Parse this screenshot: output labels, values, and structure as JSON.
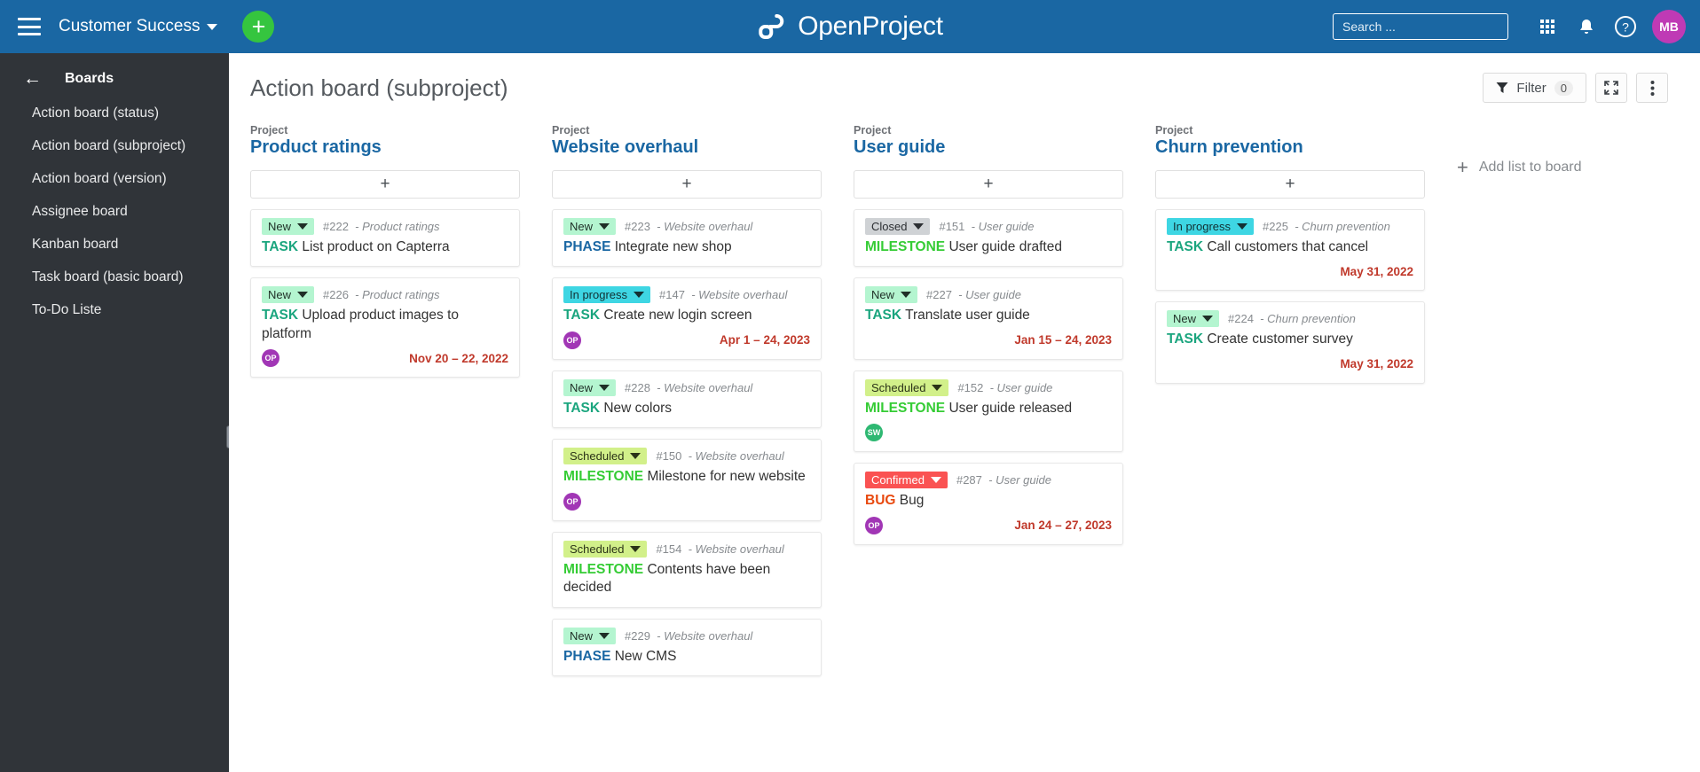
{
  "topbar": {
    "menu_icon": "hamburger-icon",
    "project_name": "Customer Success",
    "add_label": "+",
    "logo_text": "OpenProject",
    "search_placeholder": "Search ...",
    "search_value": "",
    "user_initials": "MB",
    "help_label": "?"
  },
  "sidebar": {
    "title": "Boards",
    "items": [
      {
        "label": "Action board (status)"
      },
      {
        "label": "Action board (subproject)"
      },
      {
        "label": "Action board (version)"
      },
      {
        "label": "Assignee board"
      },
      {
        "label": "Kanban board"
      },
      {
        "label": "Task board (basic board)"
      },
      {
        "label": "To-Do Liste"
      }
    ]
  },
  "page": {
    "title": "Action board (subproject)",
    "filter_label": "Filter",
    "filter_count": "0",
    "add_list_label": "Add list to board",
    "add_card_label": "+"
  },
  "colors": {
    "brand_blue": "#1a67a3",
    "sidebar_bg": "#303439",
    "green_accent": "#35c53f",
    "date_red": "#c0392b",
    "avatar_purple": "#a136b5",
    "avatar_green": "#2eb872",
    "status_new_bg": "#b4f5d0",
    "status_new_fg": "#1f2f27",
    "status_inprogress_bg": "#3ed6e3",
    "status_inprogress_fg": "#123033",
    "status_scheduled_bg": "#d2f08a",
    "status_scheduled_fg": "#2b3318",
    "status_closed_bg": "#cfd2d5",
    "status_closed_fg": "#2c2f33",
    "status_confirmed_bg": "#fa5252",
    "status_confirmed_fg": "#ffffff",
    "type_task": "#1aa57e",
    "type_phase": "#1a67a3",
    "type_milestone": "#35cc35",
    "type_bug": "#e8490f"
  },
  "board": {
    "lists": [
      {
        "project_label": "Project",
        "project_name": "Product ratings",
        "cards": [
          {
            "status": "New",
            "status_kind": "new",
            "id": "#222",
            "project": "Product ratings",
            "type": "TASK",
            "type_kind": "task",
            "subject": "List product on Capterra",
            "avatar": null,
            "date": null
          },
          {
            "status": "New",
            "status_kind": "new",
            "id": "#226",
            "project": "Product ratings",
            "type": "TASK",
            "type_kind": "task",
            "subject": "Upload product images to platform",
            "avatar": {
              "initials": "OP",
              "color_kind": "purple"
            },
            "date": "Nov 20 – 22, 2022"
          }
        ]
      },
      {
        "project_label": "Project",
        "project_name": "Website overhaul",
        "cards": [
          {
            "status": "New",
            "status_kind": "new",
            "id": "#223",
            "project": "Website overhaul",
            "type": "PHASE",
            "type_kind": "phase",
            "subject": "Integrate new shop",
            "avatar": null,
            "date": null
          },
          {
            "status": "In progress",
            "status_kind": "inprogress",
            "id": "#147",
            "project": "Website overhaul",
            "type": "TASK",
            "type_kind": "task",
            "subject": "Create new login screen",
            "avatar": {
              "initials": "OP",
              "color_kind": "purple"
            },
            "date": "Apr 1 – 24, 2023"
          },
          {
            "status": "New",
            "status_kind": "new",
            "id": "#228",
            "project": "Website overhaul",
            "type": "TASK",
            "type_kind": "task",
            "subject": "New colors",
            "avatar": null,
            "date": null
          },
          {
            "status": "Scheduled",
            "status_kind": "scheduled",
            "id": "#150",
            "project": "Website overhaul",
            "type": "MILESTONE",
            "type_kind": "milestone",
            "subject": "Milestone for new website",
            "avatar": {
              "initials": "OP",
              "color_kind": "purple"
            },
            "date": null
          },
          {
            "status": "Scheduled",
            "status_kind": "scheduled",
            "id": "#154",
            "project": "Website overhaul",
            "type": "MILESTONE",
            "type_kind": "milestone",
            "subject": "Contents have been decided",
            "avatar": null,
            "date": null
          },
          {
            "status": "New",
            "status_kind": "new",
            "id": "#229",
            "project": "Website overhaul",
            "type": "PHASE",
            "type_kind": "phase",
            "subject": "New CMS",
            "avatar": null,
            "date": null
          }
        ]
      },
      {
        "project_label": "Project",
        "project_name": "User guide",
        "cards": [
          {
            "status": "Closed",
            "status_kind": "closed",
            "id": "#151",
            "project": "User guide",
            "type": "MILESTONE",
            "type_kind": "milestone",
            "subject": "User guide drafted",
            "avatar": null,
            "date": null
          },
          {
            "status": "New",
            "status_kind": "new",
            "id": "#227",
            "project": "User guide",
            "type": "TASK",
            "type_kind": "task",
            "subject": "Translate user guide",
            "avatar": null,
            "date": "Jan 15 – 24, 2023"
          },
          {
            "status": "Scheduled",
            "status_kind": "scheduled",
            "id": "#152",
            "project": "User guide",
            "type": "MILESTONE",
            "type_kind": "milestone",
            "subject": "User guide released",
            "avatar": {
              "initials": "SW",
              "color_kind": "green"
            },
            "date": null
          },
          {
            "status": "Confirmed",
            "status_kind": "confirmed",
            "id": "#287",
            "project": "User guide",
            "type": "BUG",
            "type_kind": "bug",
            "subject": "Bug",
            "avatar": {
              "initials": "OP",
              "color_kind": "purple"
            },
            "date": "Jan 24 – 27, 2023"
          }
        ]
      },
      {
        "project_label": "Project",
        "project_name": "Churn prevention",
        "cards": [
          {
            "status": "In progress",
            "status_kind": "inprogress",
            "id": "#225",
            "project": "Churn prevention",
            "type": "TASK",
            "type_kind": "task",
            "subject": "Call customers that cancel",
            "avatar": null,
            "date": "May 31, 2022"
          },
          {
            "status": "New",
            "status_kind": "new",
            "id": "#224",
            "project": "Churn prevention",
            "type": "TASK",
            "type_kind": "task",
            "subject": "Create customer survey",
            "avatar": null,
            "date": "May 31, 2022"
          }
        ]
      }
    ]
  }
}
